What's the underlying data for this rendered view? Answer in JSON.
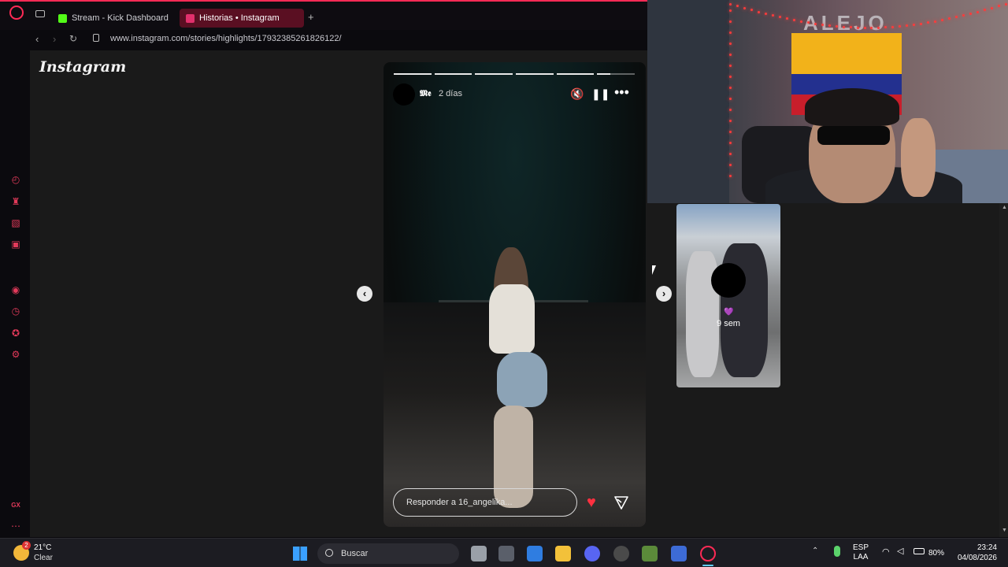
{
  "browser": {
    "tabs": [
      {
        "label": "Stream - Kick Dashboard",
        "active": false,
        "favicon_color": "#53fc18"
      },
      {
        "label": "Historias • Instagram",
        "active": true,
        "favicon_color": "#e1306c"
      }
    ],
    "new_tab_symbol": "+",
    "url": "www.instagram.com/stories/highlights/17932385261826122/"
  },
  "instagram": {
    "logo_text": "Instagram"
  },
  "story": {
    "username": "𝕸𝖊",
    "time_ago": "2 días",
    "progress_segments": 6,
    "progress_current_fraction": 0.35,
    "reply_placeholder": "Responder a 16_angelika...",
    "icons": [
      "mute-icon",
      "pause-icon",
      "more-icon",
      "heart-icon",
      "send-icon"
    ]
  },
  "next_highlight": {
    "emoji": "💜",
    "time_ago": "9 sem"
  },
  "webcam": {
    "wall_text": "ALEJO"
  },
  "taskbar": {
    "weather_temp": "21°C",
    "weather_condition": "Clear",
    "weather_badge": "2",
    "search_label": "Buscar",
    "lang_line1": "ESP",
    "lang_line2": "LAA",
    "battery": "80%",
    "time": "23:24",
    "date": "04/08/2026"
  },
  "colors": {
    "accent": "#ff2a55",
    "story_heart": "#ff3040"
  }
}
